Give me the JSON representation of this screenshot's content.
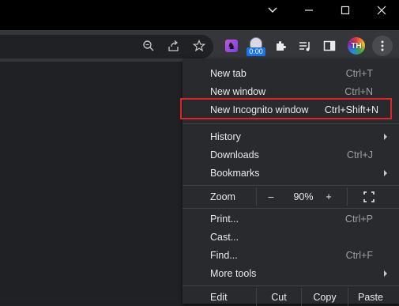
{
  "colors": {
    "titlebar": "#000000",
    "toolbar": "#35363a",
    "menu_bg": "#292a2d",
    "highlight_border": "#e0242d",
    "text": "#e8eaed",
    "shortcut_text": "#9aa0a6"
  },
  "window_controls": [
    {
      "name": "tab-search-chevron-icon"
    },
    {
      "name": "minimize-icon"
    },
    {
      "name": "maximize-icon"
    },
    {
      "name": "close-icon"
    }
  ],
  "toolbar": {
    "extension_badge": "0:00",
    "profile_initials": "TH",
    "icons": [
      "zoom-icon",
      "share-icon",
      "bookmark-star-icon",
      "extension-chess-icon",
      "extension-timer-icon",
      "extensions-puzzle-icon",
      "media-queue-icon",
      "side-panel-icon",
      "profile-avatar",
      "chrome-menu-icon"
    ]
  },
  "menu": {
    "new_tab": {
      "label": "New tab",
      "shortcut": "Ctrl+T"
    },
    "new_window": {
      "label": "New window",
      "shortcut": "Ctrl+N"
    },
    "new_incognito": {
      "label": "New Incognito window",
      "shortcut": "Ctrl+Shift+N"
    },
    "history": {
      "label": "History"
    },
    "downloads": {
      "label": "Downloads",
      "shortcut": "Ctrl+J"
    },
    "bookmarks": {
      "label": "Bookmarks"
    },
    "zoom": {
      "label": "Zoom",
      "minus": "–",
      "value": "90%",
      "plus": "+"
    },
    "print": {
      "label": "Print...",
      "shortcut": "Ctrl+P"
    },
    "cast": {
      "label": "Cast..."
    },
    "find": {
      "label": "Find...",
      "shortcut": "Ctrl+F"
    },
    "more_tools": {
      "label": "More tools"
    },
    "edit": {
      "label": "Edit",
      "cut": "Cut",
      "copy": "Copy",
      "paste": "Paste"
    }
  }
}
